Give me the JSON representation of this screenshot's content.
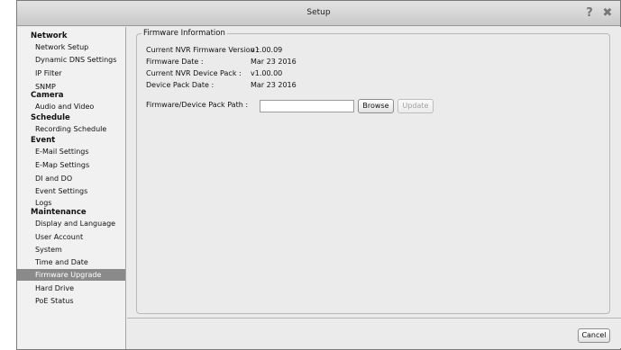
{
  "window": {
    "title": "Setup"
  },
  "titlebar": {
    "help_icon": "help-question-icon",
    "close_icon": "close-icon"
  },
  "sidebar": {
    "categories": [
      {
        "label": "Network",
        "items": [
          "Network Setup",
          "Dynamic DNS Settings",
          "IP Filter",
          "SNMP"
        ]
      },
      {
        "label": "Camera",
        "items": [
          "Audio and Video"
        ]
      },
      {
        "label": "Schedule",
        "items": [
          "Recording Schedule"
        ]
      },
      {
        "label": "Event",
        "items": [
          "E-Mail Settings",
          "E-Map Settings",
          "DI and DO",
          "Event Settings",
          "Logs"
        ]
      },
      {
        "label": "Maintenance",
        "items": [
          "Display and Language",
          "User Account",
          "System",
          "Time and Date",
          "Firmware Upgrade",
          "Hard Drive",
          "PoE Status"
        ]
      }
    ],
    "selected": "Firmware Upgrade"
  },
  "firmware": {
    "group_title": "Firmware Information",
    "nvr_version_label": "Current NVR Firmware Version :",
    "nvr_version_value": "v1.00.09",
    "firmware_date_label": "Firmware Date :",
    "firmware_date_value": "Mar 23 2016",
    "device_pack_label": "Current NVR Device Pack :",
    "device_pack_value": "v1.00.00",
    "pack_date_label": "Device Pack Date :",
    "pack_date_value": "Mar 23 2016",
    "path_label": "Firmware/Device Pack Path :",
    "path_value": "",
    "browse_label": "Browse",
    "update_label": "Update"
  },
  "footer": {
    "cancel_label": "Cancel"
  }
}
